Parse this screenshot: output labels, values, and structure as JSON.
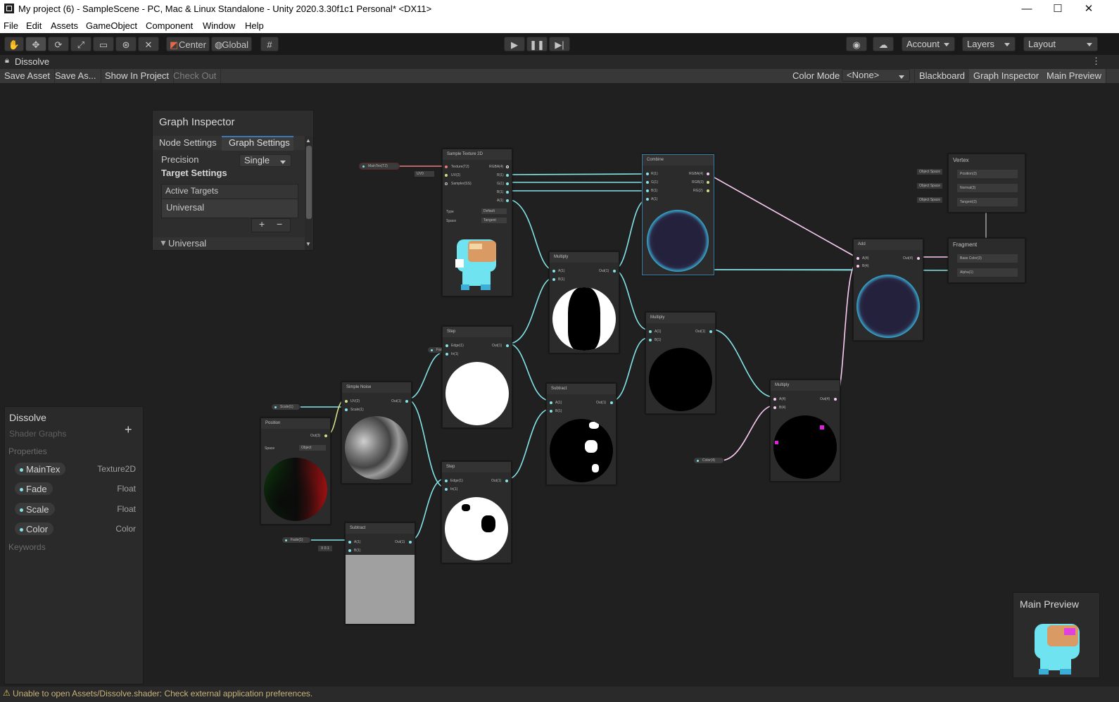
{
  "window": {
    "title": "My project (6) - SampleScene - PC, Mac & Linux Standalone - Unity 2020.3.30f1c1 Personal* <DX11>",
    "controls": [
      "—",
      "☐",
      "✕"
    ]
  },
  "menu": [
    "File",
    "Edit",
    "Assets",
    "GameObject",
    "Component",
    "Window",
    "Help"
  ],
  "toolbar": {
    "pivot_label": "Center",
    "space_label": "Global",
    "account_label": "Account",
    "layers_label": "Layers",
    "layout_label": "Layout"
  },
  "tab": {
    "title": "Dissolve"
  },
  "graph_toolbar": {
    "save_asset": "Save Asset",
    "save_as": "Save As...",
    "show_in_project": "Show In Project",
    "check_out": "Check Out",
    "color_mode_label": "Color Mode",
    "color_mode_value": "<None>",
    "blackboard": "Blackboard",
    "graph_inspector": "Graph Inspector",
    "main_preview": "Main Preview"
  },
  "inspector": {
    "title": "Graph Inspector",
    "tab_node_settings": "Node Settings",
    "tab_graph_settings": "Graph Settings",
    "precision_label": "Precision",
    "precision_value": "Single",
    "target_settings": "Target Settings",
    "active_targets": "Active Targets",
    "target_item": "Universal",
    "add": "+",
    "remove": "−",
    "foldout": "Universal"
  },
  "blackboard": {
    "title": "Dissolve",
    "subtitle": "Shader Graphs",
    "add": "+",
    "section_properties": "Properties",
    "properties": [
      {
        "name": "MainTex",
        "type": "Texture2D"
      },
      {
        "name": "Fade",
        "type": "Float"
      },
      {
        "name": "Scale",
        "type": "Float"
      },
      {
        "name": "Color",
        "type": "Color"
      }
    ],
    "section_keywords": "Keywords"
  },
  "main_preview": {
    "title": "Main Preview"
  },
  "nodes": {
    "sample_texture": {
      "title": "Sample Texture 2D",
      "in": [
        "Texture(T2)",
        "UV(2)",
        "Sampler(SS)"
      ],
      "out": [
        "RGBA(4)",
        "R(1)",
        "G(1)",
        "B(1)",
        "A(1)"
      ],
      "type_label": "Type",
      "type_value": "Default",
      "space_label": "Space",
      "space_value": "Tangent",
      "uv_value": "UV0"
    },
    "combine": {
      "title": "Combine",
      "in": [
        "R(1)",
        "G(1)",
        "B(1)",
        "A(1)"
      ],
      "out": [
        "RGBA(4)",
        "RGB(3)",
        "RG(2)"
      ]
    },
    "vertex": {
      "title": "Vertex",
      "rows": [
        "Position(3)",
        "Normal(3)",
        "Tangent(3)"
      ],
      "space": "Object Space"
    },
    "fragment": {
      "title": "Fragment",
      "rows": [
        "Base Color(3)",
        "Alpha(1)"
      ]
    },
    "add": {
      "title": "Add",
      "in": [
        "A(4)",
        "B(4)"
      ],
      "out": "Out(4)"
    },
    "multiply_top": {
      "title": "Multiply",
      "in": [
        "A(1)",
        "B(1)"
      ],
      "out": "Out(1)"
    },
    "multiply_mid": {
      "title": "Multiply",
      "in": [
        "A(1)",
        "B(1)"
      ],
      "out": "Out(1)"
    },
    "multiply_right": {
      "title": "Multiply",
      "in": [
        "A(4)",
        "B(4)"
      ],
      "out": "Out(4)"
    },
    "step_top": {
      "title": "Step",
      "in": [
        "Edge(1)",
        "In(1)"
      ],
      "out": "Out(1)"
    },
    "step_bottom": {
      "title": "Step",
      "in": [
        "Edge(1)",
        "In(1)"
      ],
      "out": "Out(1)"
    },
    "subtract_mid": {
      "title": "Subtract",
      "in": [
        "A(1)",
        "B(1)"
      ],
      "out": "Out(1)"
    },
    "subtract_bottom": {
      "title": "Subtract",
      "in": [
        "A(1)",
        "B(1)"
      ],
      "out": "Out(1)",
      "b_value": "0.1",
      "b_axis": "X"
    },
    "simple_noise": {
      "title": "Simple Noise",
      "in": [
        "UV(2)",
        "Scale(1)"
      ],
      "out": "Out(1)"
    },
    "position": {
      "title": "Position",
      "out": "Out(3)",
      "space_label": "Space",
      "space_value": "Object"
    }
  },
  "pills": {
    "maintex": "MainTex(T2)",
    "fade1": "Fade(1)",
    "fade2": "Fade(1)",
    "scale": "Scale(1)",
    "color": "Color(4)"
  },
  "status": {
    "message": "Unable to open Assets/Dissolve.shader: Check external application preferences."
  },
  "colors": {
    "float_port": "#84e4e7",
    "vector_port": "#fbcbf4",
    "texture_port": "#e97c7c",
    "vector2_port": "#cfe28b"
  }
}
